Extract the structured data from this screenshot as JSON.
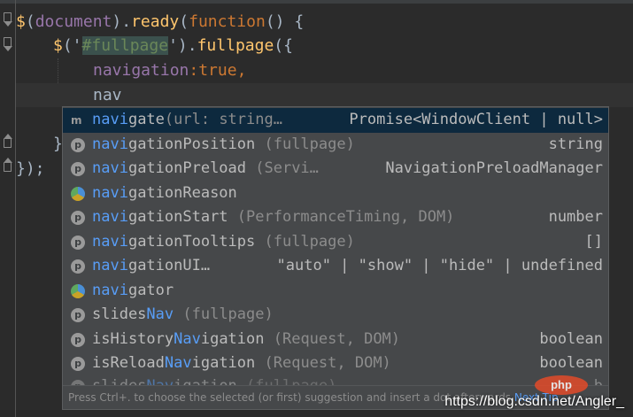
{
  "code": {
    "line1": {
      "dollar": "$",
      "open": "(",
      "arg": "document",
      "mid": ").",
      "method": "ready",
      "open2": "(",
      "keyword": "function",
      "rest": "() {"
    },
    "line2": {
      "dollar": "$",
      "open": "('",
      "selector": "#fullpage",
      "mid": "').",
      "method": "fullpage",
      "open2": "(",
      "rest": "{"
    },
    "line3": {
      "key": "navigation",
      "colon": ":",
      "value": "true",
      "comma": ","
    },
    "line4": {
      "typed": "nav"
    },
    "line5": {
      "text": "}"
    },
    "line6": {
      "text": "});"
    }
  },
  "autocomplete": {
    "items": [
      {
        "match": "navi",
        "rest": "gate",
        "tail": "(url: string…",
        "type": "Promise<WindowClient | null>",
        "icon": "method-icon"
      },
      {
        "match": "navi",
        "rest": "gationPosition",
        "tail": " (fullpage)",
        "type": "string",
        "icon": "property-icon"
      },
      {
        "match": "navi",
        "rest": "gationPreload",
        "tail": " (Servi…",
        "type": "NavigationPreloadManager",
        "icon": "property-icon"
      },
      {
        "match": "navi",
        "rest": "gationReason",
        "tail": "",
        "type": "",
        "icon": "variable-icon"
      },
      {
        "match": "navi",
        "rest": "gationStart",
        "tail": " (PerformanceTiming, DOM)",
        "type": "number",
        "icon": "property-icon"
      },
      {
        "match": "navi",
        "rest": "gationTooltips",
        "tail": " (fullpage)",
        "type": "[]",
        "icon": "property-icon"
      },
      {
        "match": "navi",
        "rest": "gationUI…",
        "tail": "",
        "type": "\"auto\" | \"show\" | \"hide\" | undefined",
        "icon": "property-icon"
      },
      {
        "match": "navi",
        "rest": "gator",
        "tail": "",
        "type": "",
        "icon": "variable-icon"
      },
      {
        "pre": "slides",
        "match": "Nav",
        "tail": " (fullpage)",
        "type": "",
        "icon": "property-icon"
      },
      {
        "pre": "isHistory",
        "match": "Nav",
        "rest": "igation",
        "tail": " (Request, DOM)",
        "type": "boolean",
        "icon": "property-icon"
      },
      {
        "pre": "isReload",
        "match": "Nav",
        "rest": "igation",
        "tail": " (Request, DOM)",
        "type": "boolean",
        "icon": "property-icon"
      },
      {
        "pre": "slides",
        "match": "Nav",
        "rest": "igation",
        "tail": " (fullpage)",
        "type": "b",
        "icon": "property-icon"
      }
    ],
    "icon_glyphs": {
      "property": "p",
      "method": "m"
    },
    "footer_hint": "Press Ctrl+. to choose the selected (or first) suggestion and insert a dot afterwards",
    "footer_link": "Next Tip"
  },
  "watermark": {
    "logo": "php",
    "text": "https://blog.csdn.net/Angler_"
  },
  "colors": {
    "background": "#2b2b2b",
    "popup": "#46484a",
    "selected": "#0d293e",
    "match": "#589df6",
    "keyword": "#cc7832",
    "string": "#6a8759",
    "method": "#ffc66d",
    "property": "#9876aa"
  }
}
